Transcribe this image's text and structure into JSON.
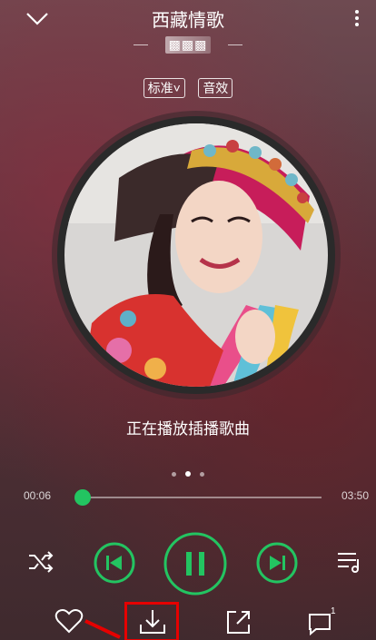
{
  "header": {
    "song_title": "西藏情歌",
    "artist": "▩▩▩",
    "quality_label": "标准",
    "effect_label": "音效"
  },
  "now_playing_text": "正在播放插播歌曲",
  "page_indicator": {
    "count": 3,
    "active": 1
  },
  "progress": {
    "elapsed": "00:06",
    "duration": "03:50",
    "fraction": 0.026
  },
  "accent_color": "#23c461",
  "highlight_color": "#e60000",
  "icons": [
    "chevron-down-icon",
    "more-icon",
    "shuffle-icon",
    "previous-icon",
    "pause-icon",
    "next-icon",
    "playlist-icon",
    "heart-icon",
    "download-icon",
    "share-icon",
    "comment-icon"
  ],
  "comment_count": "1"
}
